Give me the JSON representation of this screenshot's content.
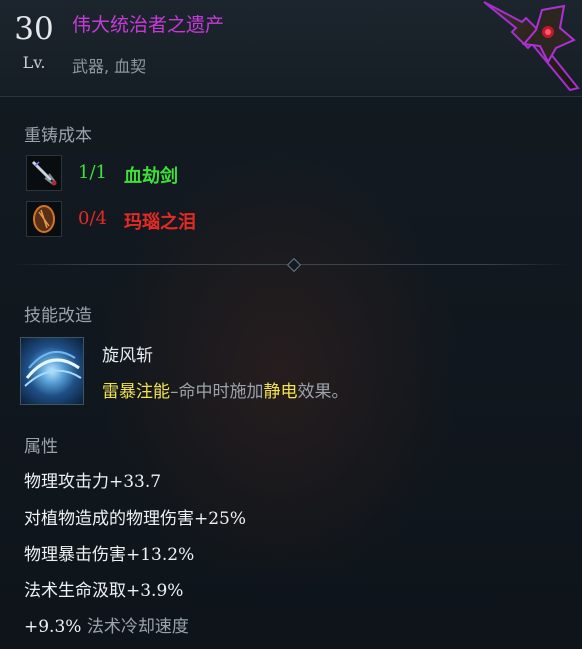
{
  "header": {
    "level": "30",
    "level_label": "Lv.",
    "item_name": "伟大统治者之遗产",
    "item_type": "武器, 血契",
    "name_color": "#c63bd8"
  },
  "reforge": {
    "title": "重铸成本",
    "materials": [
      {
        "count": "1/1",
        "name": "血劫剑",
        "status": "sufficient",
        "icon": "sword-icon"
      },
      {
        "count": "0/4",
        "name": "玛瑙之泪",
        "status": "insufficient",
        "icon": "tear-icon"
      }
    ]
  },
  "skill_mod": {
    "title": "技能改造",
    "skill_name": "旋风斩",
    "desc_keyword": "雷暴注能",
    "desc_mid": "–命中时施加",
    "desc_effect": "静电",
    "desc_end": "效果。",
    "icon": "whirlwind-icon"
  },
  "attributes": {
    "title": "属性",
    "stats": [
      {
        "label": "物理攻击力",
        "value": "+33.7"
      },
      {
        "label": "对植物造成的物理伤害",
        "value": "+25%"
      },
      {
        "label": "物理暴击伤害",
        "value": "+13.2%"
      },
      {
        "label": "法术生命汲取",
        "value": "+3.9%"
      }
    ],
    "last_stat": {
      "value": "+9.3%",
      "label": "法术冷却速度"
    }
  },
  "colors": {
    "sufficient": "#3ee13a",
    "insufficient": "#e52a26",
    "highlight": "#f1e34a"
  }
}
